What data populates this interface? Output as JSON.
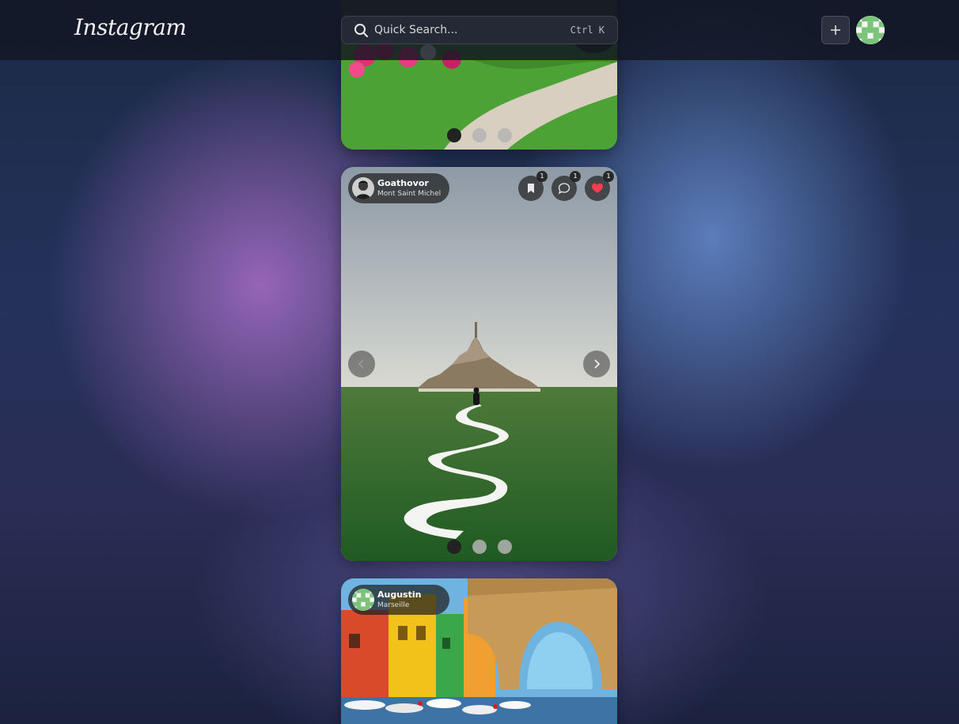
{
  "header": {
    "logo_text": "Instagram",
    "search_placeholder": "Quick Search...",
    "search_shortcut": "Ctrl K",
    "new_post_icon": "plus-icon",
    "avatar_icon": "user-avatar-icon"
  },
  "posts": [
    {
      "scene": "garden path with flowers",
      "carousel_total": 3,
      "carousel_active": 1
    },
    {
      "author": "Goathovor",
      "location": "Mont Saint Michel",
      "scene": "Mont Saint Michel with winding river",
      "saves": "1",
      "comments": "1",
      "likes": "1",
      "liked": true,
      "carousel_total": 3,
      "carousel_active": 1
    },
    {
      "author": "Augustin",
      "location": "Marseille",
      "scene": "colorful harbour houses and stone bridge"
    }
  ],
  "colors": {
    "topbar": "#121622",
    "like_active": "#ff3b4f",
    "avatar_green": "#7cc37a"
  }
}
